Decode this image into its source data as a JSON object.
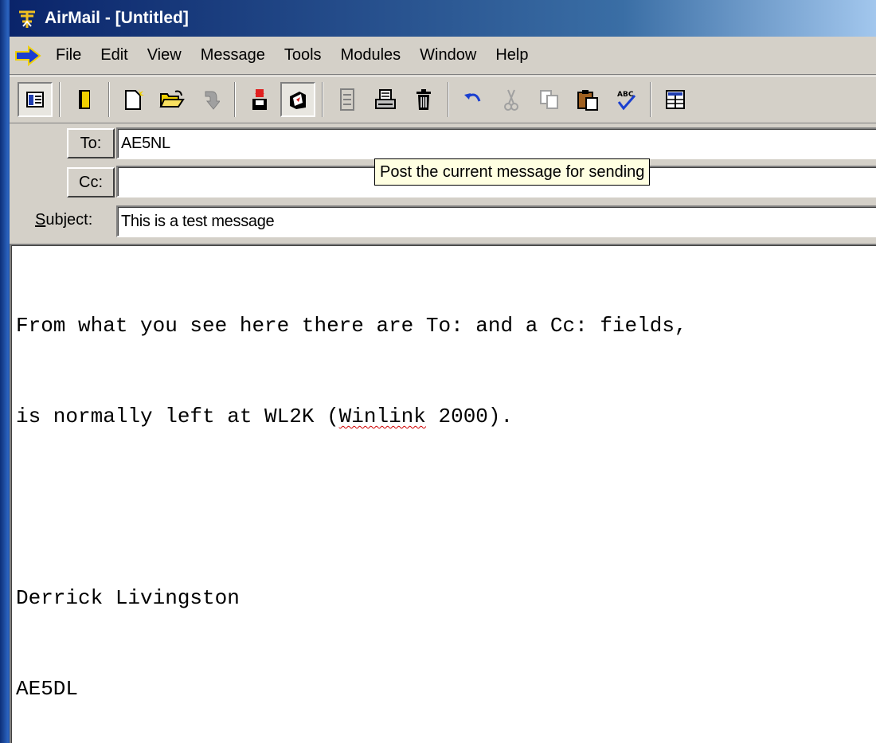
{
  "window": {
    "title": "AirMail - [Untitled]"
  },
  "menu": {
    "items": [
      "File",
      "Edit",
      "View",
      "Message",
      "Tools",
      "Modules",
      "Window",
      "Help"
    ]
  },
  "toolbar": {
    "buttons": [
      {
        "icon": "folder-list-icon",
        "pressed": true
      },
      {
        "icon": "address-book-icon"
      },
      {
        "icon": "new-message-icon"
      },
      {
        "icon": "open-folder-icon"
      },
      {
        "icon": "reply-arrow-icon"
      },
      {
        "icon": "save-disk-icon"
      },
      {
        "icon": "post-message-icon",
        "pressed": true
      },
      {
        "icon": "form-icon"
      },
      {
        "icon": "print-icon"
      },
      {
        "icon": "delete-trash-icon"
      },
      {
        "icon": "undo-icon"
      },
      {
        "icon": "cut-icon"
      },
      {
        "icon": "copy-icon"
      },
      {
        "icon": "paste-icon"
      },
      {
        "icon": "spellcheck-icon"
      },
      {
        "icon": "table-icon"
      }
    ]
  },
  "header": {
    "to_label": "To:",
    "to_value": "AE5NL",
    "cc_label": "Cc:",
    "cc_value": "",
    "subject_label_underlined": "S",
    "subject_label_rest": "ubject:",
    "subject_value": "This is a test message"
  },
  "tooltip": {
    "text": "Post the current message for sending"
  },
  "body": {
    "line1": "From what you see here there are To: and a Cc: fields, ",
    "line2_before": "is normally left at WL2K (",
    "line2_misspelled": "Winlink",
    "line2_after": " 2000).",
    "line3": "",
    "line4": "Derrick Livingston",
    "line5": "AE5DL"
  },
  "colors": {
    "titlebar_start": "#0a246a",
    "titlebar_end": "#a6caf0",
    "window_face": "#d4d0c8",
    "tooltip_bg": "#ffffe1",
    "spell_error": "#d00000"
  }
}
